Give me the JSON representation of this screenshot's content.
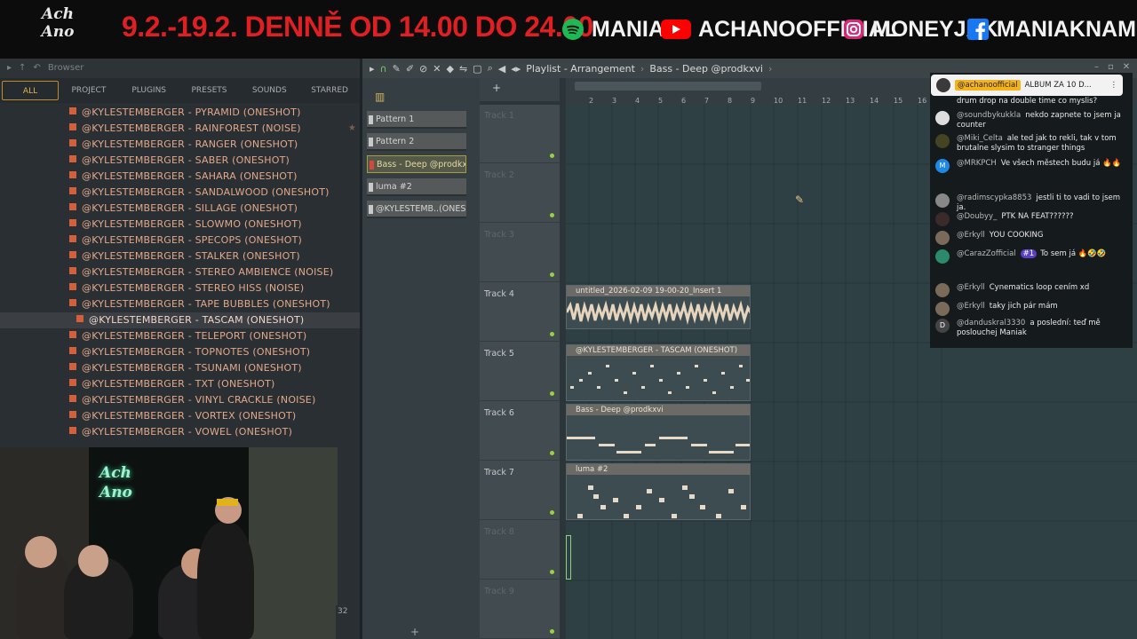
{
  "banner": {
    "dates": "9.2.-19.2. DENNĚ OD 14.00 DO 24.00",
    "logo": "Ach Ano",
    "socials": [
      {
        "icon": "spotify-icon",
        "label": "MANIAK",
        "color": "#1db954"
      },
      {
        "icon": "youtube-icon",
        "label": "ACHANOOFFICIAL",
        "color": "#ff0000"
      },
      {
        "icon": "instagram-icon",
        "label": "MONEYJAK",
        "color": "#e1306c"
      },
      {
        "icon": "facebook-icon",
        "label": "MANIAKNAME",
        "color": "#1877f2"
      }
    ]
  },
  "browser": {
    "title": "Browser",
    "tabs": [
      "ALL",
      "PROJECT",
      "PLUGINS",
      "PRESETS",
      "SOUNDS",
      "STARRED"
    ],
    "items": [
      "@KYLESTEMBERGER - PYRAMID (ONESHOT)",
      "@KYLESTEMBERGER - RAINFOREST (NOISE)",
      "@KYLESTEMBERGER - RANGER (ONESHOT)",
      "@KYLESTEMBERGER - SABER (ONESHOT)",
      "@KYLESTEMBERGER - SAHARA (ONESHOT)",
      "@KYLESTEMBERGER - SANDALWOOD (ONESHOT)",
      "@KYLESTEMBERGER - SILLAGE (ONESHOT)",
      "@KYLESTEMBERGER - SLOWMO (ONESHOT)",
      "@KYLESTEMBERGER - SPECOPS (ONESHOT)",
      "@KYLESTEMBERGER - STALKER (ONESHOT)",
      "@KYLESTEMBERGER - STEREO AMBIENCE (NOISE)",
      "@KYLESTEMBERGER - STEREO HISS (NOISE)",
      "@KYLESTEMBERGER - TAPE BUBBLES (ONESHOT)",
      "@KYLESTEMBERGER - TASCAM (ONESHOT)",
      "@KYLESTEMBERGER - TELEPORT (ONESHOT)",
      "@KYLESTEMBERGER - TOPNOTES (ONESHOT)",
      "@KYLESTEMBERGER - TSUNAMI (ONESHOT)",
      "@KYLESTEMBERGER - TXT (ONESHOT)",
      "@KYLESTEMBERGER - VINYL CRACKLE (NOISE)",
      "@KYLESTEMBERGER - VORTEX (ONESHOT)",
      "@KYLESTEMBERGER - VOWEL (ONESHOT)"
    ],
    "cam_corner": "32"
  },
  "playlist": {
    "title": "Playlist - Arrangement",
    "pattern_name": "Bass - Deep @prodkxvi",
    "patterns": [
      "Pattern 1",
      "Pattern 2",
      "Bass - Deep @prodkxvi",
      "luma #2",
      "@KYLESTEMB..(ONESHOT)"
    ],
    "ruler": [
      "2",
      "3",
      "4",
      "5",
      "6",
      "7",
      "8",
      "9",
      "10",
      "11",
      "12",
      "13",
      "14",
      "15",
      "16"
    ],
    "tracks": [
      "Track 1",
      "Track 2",
      "Track 3",
      "Track 4",
      "Track 5",
      "Track 6",
      "Track 7",
      "Track 8",
      "Track 9"
    ],
    "clips": [
      {
        "label": "untitled_2026-02-09 19-00-20_Insert 1"
      },
      {
        "label": "@KYLESTEMBERGER - TASCAM (ONESHOT)"
      },
      {
        "label": "Bass - Deep @prodkxvi"
      },
      {
        "label": "luma #2"
      }
    ]
  },
  "chat": {
    "pinned": {
      "user": "@achanoofficial",
      "text": "ALBUM ZA 10 D..."
    },
    "messages": [
      {
        "user": "",
        "text": "drum drop na double time co myslis?"
      },
      {
        "user": "@soundbykukkla",
        "text": "nekdo zapnete to jsem ja counter"
      },
      {
        "user": "@Miki_Celta",
        "text": "ale ted jak to rekli, tak v tom brutalne slysim to stranger things"
      },
      {
        "user": "@MRKPCH",
        "text": "Ve všech městech budu já 🔥🔥",
        "avatar": "M"
      },
      {
        "user": "@radimscypka8853",
        "text": "jestli ti to vadi to jsem ja."
      },
      {
        "user": "@Doubyy_",
        "text": "PTK NA FEAT??????"
      },
      {
        "user": "@Erkyll",
        "text": "YOU COOKING"
      },
      {
        "user": "@CarazZofficial",
        "badge": "#1",
        "text": "To sem já 🔥🤣🤣"
      },
      {
        "user": "@Erkyll",
        "text": "Cynematics loop cením xd"
      },
      {
        "user": "@Erkyll",
        "text": "taky jich pár mám"
      },
      {
        "user": "@danduskral3330",
        "text": "a poslední: teď mě poslouchej Maniak",
        "avatar": "D"
      }
    ]
  }
}
